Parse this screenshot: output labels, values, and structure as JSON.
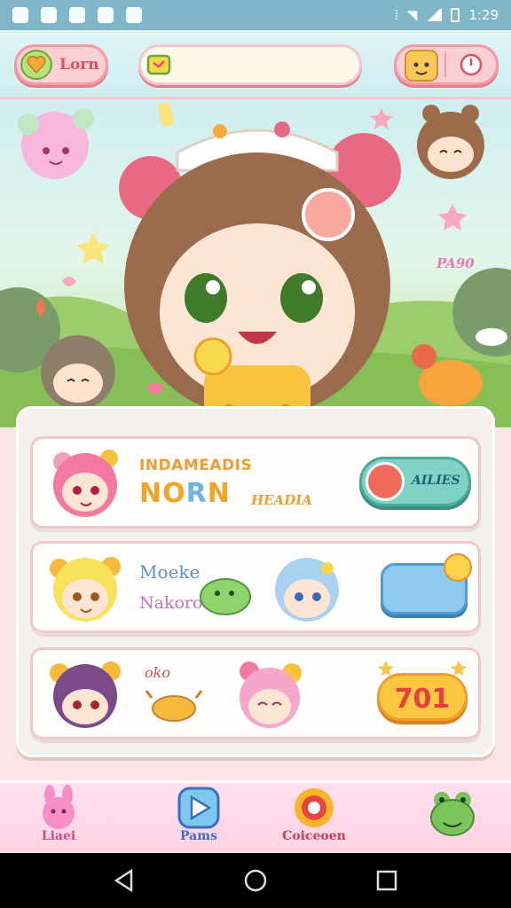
{
  "status_bar": {
    "time": "1:29"
  },
  "hud": {
    "love_label": "Lorn",
    "search_placeholder": ""
  },
  "hero": {
    "side_text": "PA90"
  },
  "cards": [
    {
      "title_top": "INDAMEADIS",
      "title_main_1": "NO",
      "title_main_2": "R",
      "title_main_3": "N",
      "title_sub": "HEADIA",
      "button_label": "AILIES"
    },
    {
      "line_1": "Moeke",
      "line_2": "Nakoro"
    },
    {
      "line_1": "oko",
      "coins": "701"
    }
  ],
  "bottom_nav": [
    {
      "label": "Liaei",
      "icon": "bunny-icon"
    },
    {
      "label": "Pams",
      "icon": "play-triangle-icon"
    },
    {
      "label": "Coiceoen",
      "icon": "sunflower-icon"
    },
    {
      "label": "",
      "icon": "frog-icon"
    }
  ],
  "colors": {
    "accent_pink": "#f29aa6",
    "teal": "#7fd3c6",
    "gold": "#fbc740",
    "nav_bg": "#ffd3e4"
  }
}
